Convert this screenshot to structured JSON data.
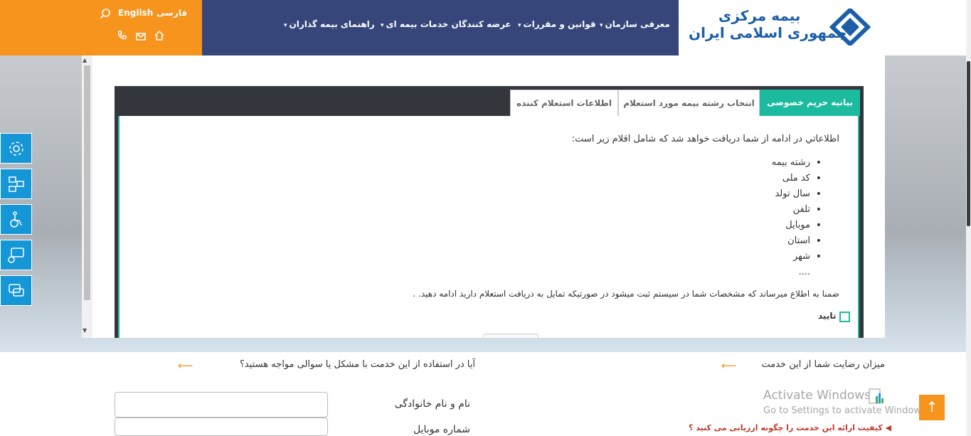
{
  "header": {
    "lang_fa": "فارسی",
    "lang_en": "English",
    "nav": [
      {
        "label": "معرفی سازمان"
      },
      {
        "label": "قوانین و مقررات"
      },
      {
        "label": "عرضه کنندگان خدمات بیمه ای"
      },
      {
        "label": "راهنمای بیمه گذاران"
      }
    ],
    "logo_line1": "بیمه مرکزی",
    "logo_line2": "جمهوری اسلامی ایران"
  },
  "tabs": [
    {
      "label": "بیانیه حریم خصوصی",
      "active": true
    },
    {
      "label": "انتخاب رشته بیمه مورد استعلام",
      "active": false
    },
    {
      "label": "اطلاعات استعلام کننده",
      "active": false
    }
  ],
  "privacy": {
    "intro": "اطلاعاتي در ادامه از شما دریافت خواهد شد که شامل اقلام زیر است:",
    "items": [
      "رشته بیمه",
      "کد ملی",
      "سال تولد",
      "تلفن",
      "موبایل",
      "استان",
      "شهر",
      "...."
    ],
    "notice": "ضمنا به اطلاع میرساند که مشخصات شما در سیستم ثبت میشود در صورتیکه تمایل به دریافت استعلام دارید ادامه دهید. .",
    "confirm_label": "تایید"
  },
  "footer": {
    "satisfaction_title": "میزان رضایت شما از این خدمت",
    "problem_title": "آیا در استفاده از این خدمت با مشکل یا سوالی مواجه هستید؟",
    "name_label": "نام و نام خانوادگی",
    "mobile_label": "شماره موبایل",
    "eval_question": "کیفیت ارائه این خدمت را چگونه ارزیابی می کنید ؟",
    "windows_line1": "Activate Windows",
    "windows_line2": "Go to Settings to activate Windows."
  },
  "colors": {
    "accent_orange": "#f7941d",
    "nav_blue": "#36457a",
    "teal": "#1cbba0",
    "side_blue": "#1596d6"
  }
}
